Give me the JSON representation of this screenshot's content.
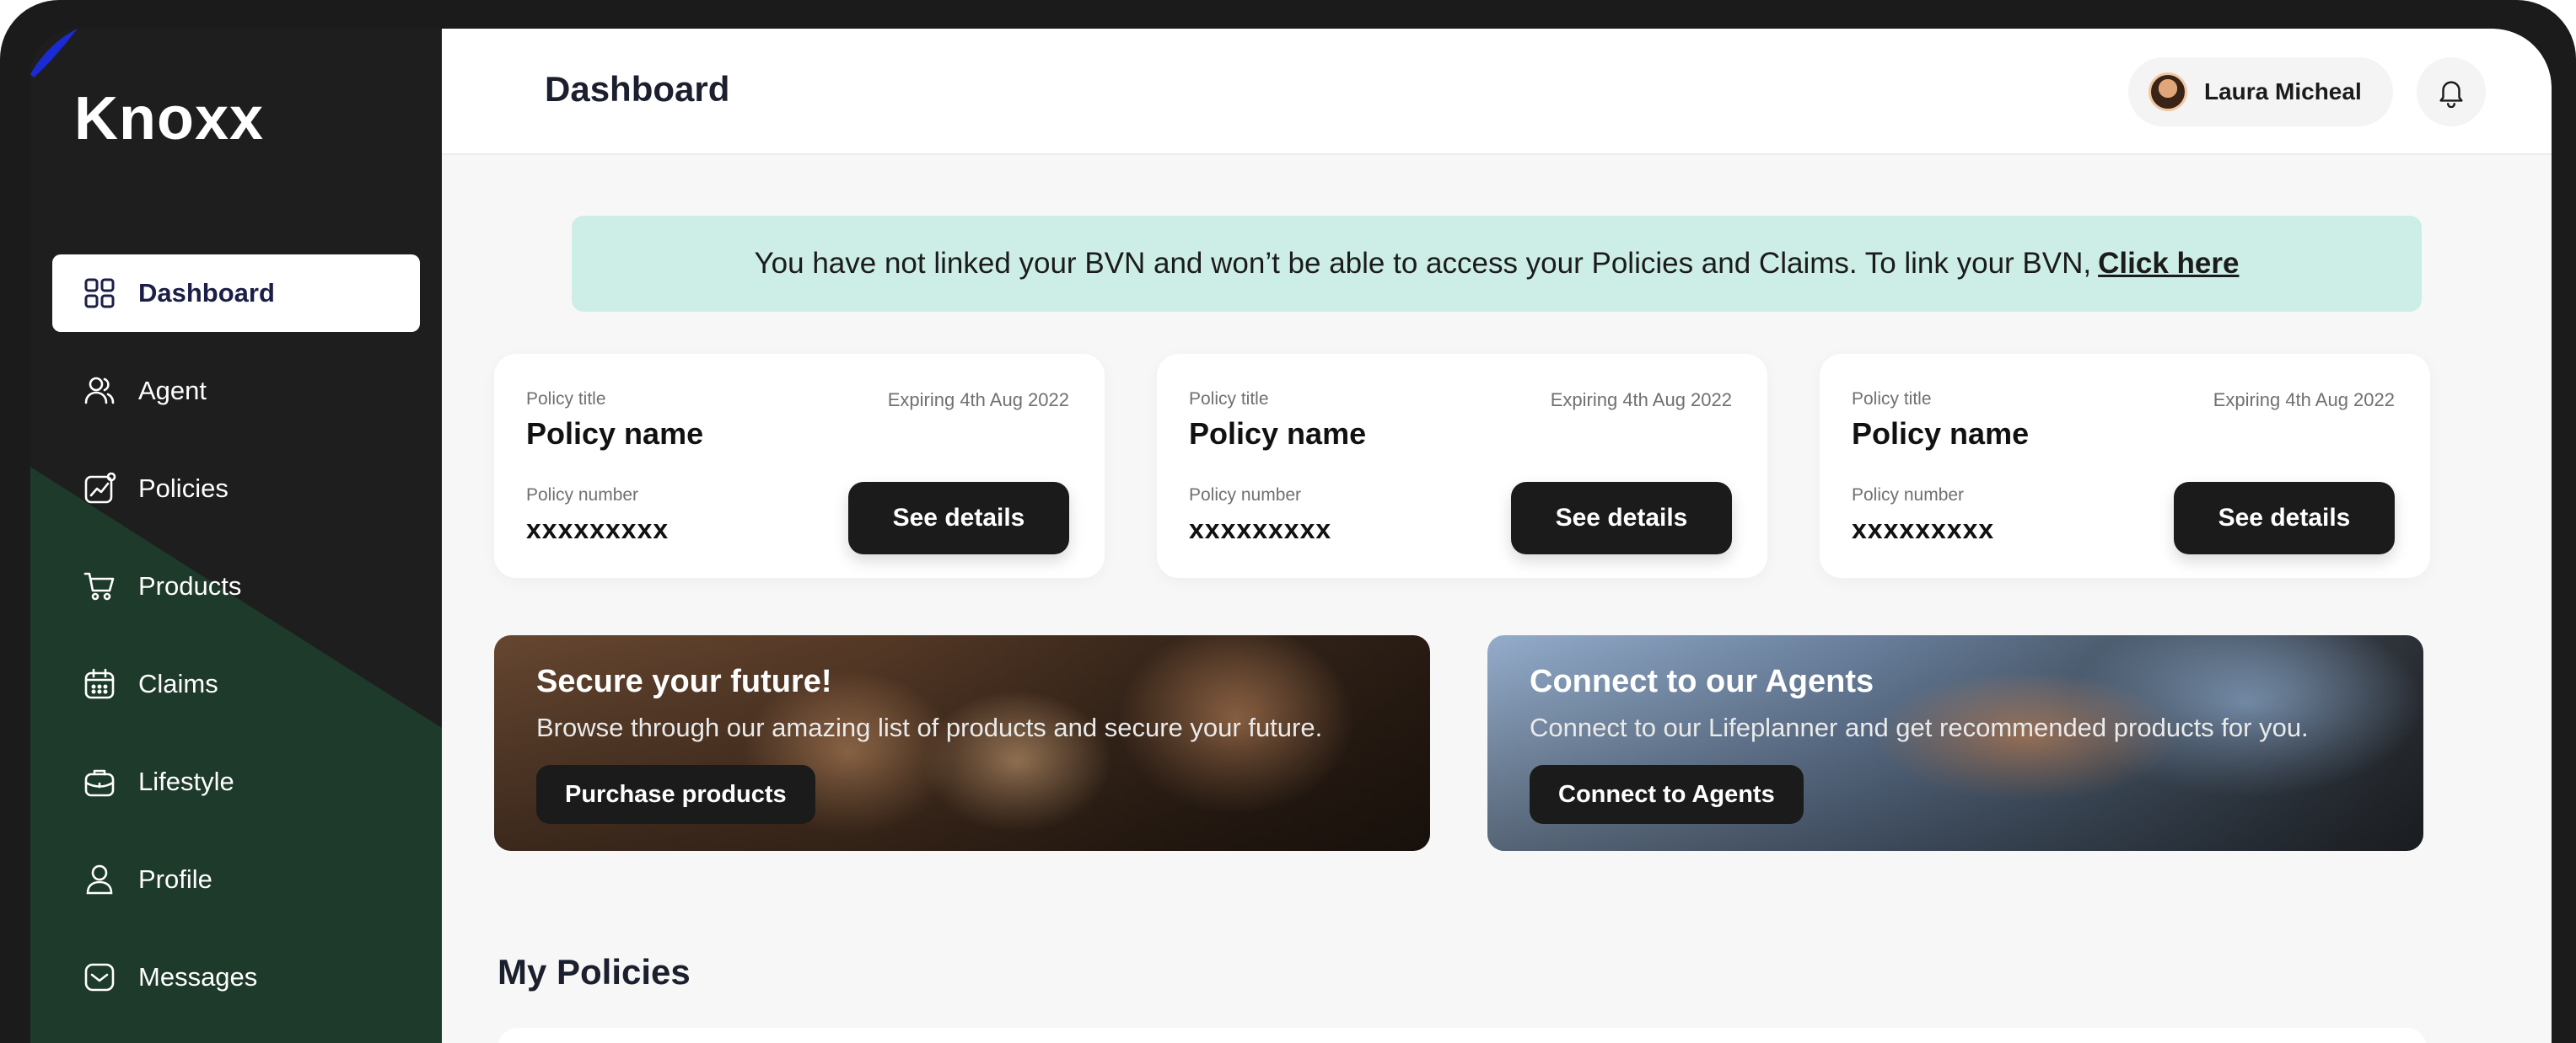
{
  "brand": {
    "name": "Knoxx",
    "accent": "#1a2bd6",
    "sidebar_green": "#1d3a2a"
  },
  "sidebar": {
    "items": [
      {
        "label": "Dashboard",
        "icon": "grid-icon",
        "active": true
      },
      {
        "label": "Agent",
        "icon": "users-icon"
      },
      {
        "label": "Policies",
        "icon": "chart-icon"
      },
      {
        "label": "Products",
        "icon": "cart-icon"
      },
      {
        "label": "Claims",
        "icon": "calendar-icon"
      },
      {
        "label": "Lifestyle",
        "icon": "briefcase-icon"
      },
      {
        "label": "Profile",
        "icon": "user-icon"
      },
      {
        "label": "Messages",
        "icon": "mail-icon"
      }
    ]
  },
  "header": {
    "title": "Dashboard",
    "user_name": "Laura Micheal"
  },
  "banner": {
    "text": "You have not linked your BVN and won’t be able to access your Policies and Claims. To link your BVN,",
    "link": "Click here"
  },
  "policy_cards": [
    {
      "title_label": "Policy title",
      "name": "Policy name",
      "expiry": "Expiring 4th Aug 2022",
      "number_label": "Policy number",
      "number": "xxxxxxxxx",
      "button": "See details"
    },
    {
      "title_label": "Policy title",
      "name": "Policy name",
      "expiry": "Expiring 4th Aug 2022",
      "number_label": "Policy number",
      "number": "xxxxxxxxx",
      "button": "See details"
    },
    {
      "title_label": "Policy title",
      "name": "Policy name",
      "expiry": "Expiring 4th Aug 2022",
      "number_label": "Policy number",
      "number": "xxxxxxxxx",
      "button": "See details"
    }
  ],
  "promos": [
    {
      "title": "Secure your future!",
      "subtitle": "Browse through our amazing list of products and secure your future.",
      "button": "Purchase products"
    },
    {
      "title": "Connect to our Agents",
      "subtitle": "Connect to our Lifeplanner and get recommended products for you.",
      "button": "Connect to Agents"
    }
  ],
  "my_policies": {
    "title": "My Policies"
  }
}
